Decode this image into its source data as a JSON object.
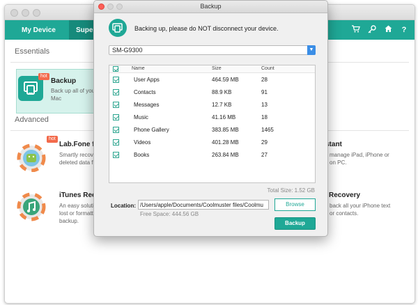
{
  "main": {
    "nav": {
      "my_device": "My Device",
      "super_toolkit": "Super"
    },
    "sections": {
      "essentials": "Essentials",
      "advanced": "Advanced"
    },
    "features": {
      "backup": {
        "title": "Backup",
        "desc1": "Back up all of your",
        "desc2": "Mac",
        "badge": "hot"
      },
      "labfone": {
        "title": "Lab.Fone fo",
        "desc1": "Smartly recove",
        "desc2": "deleted data fr",
        "badge": "hot"
      },
      "itunes": {
        "title": "iTunes Recov",
        "desc1": "An easy solution",
        "desc2": "lost or formatted",
        "desc3": "backup."
      },
      "assistant": {
        "title": "stant",
        "desc1": "manage iPad, iPhone or",
        "desc2": "on PC."
      },
      "recovery": {
        "title": "Recovery",
        "desc1": "back all your iPhone text",
        "desc2": "or contacts."
      }
    }
  },
  "dialog": {
    "title": "Backup",
    "status": "Backing up, please do NOT disconnect your device.",
    "device": "SM-G9300",
    "columns": {
      "name": "Name",
      "size": "Size",
      "count": "Count"
    },
    "items": [
      {
        "name": "User Apps",
        "size": "464.59 MB",
        "count": "28"
      },
      {
        "name": "Contacts",
        "size": "88.9 KB",
        "count": "91"
      },
      {
        "name": "Messages",
        "size": "12.7 KB",
        "count": "13"
      },
      {
        "name": "Music",
        "size": "41.16 MB",
        "count": "18"
      },
      {
        "name": "Phone Gallery",
        "size": "383.85 MB",
        "count": "1465"
      },
      {
        "name": "Videos",
        "size": "401.28 MB",
        "count": "29"
      },
      {
        "name": "Books",
        "size": "263.84 MB",
        "count": "27"
      }
    ],
    "total_size": "Total Size: 1.52 GB",
    "location_label": "Location:",
    "location_path": "/Users/apple/Documents/Coolmuster files/Coolmu",
    "free_space": "Free Space: 444.56 GB",
    "browse": "Browse",
    "backup": "Backup"
  },
  "colors": {
    "accent": "#1fa896",
    "accent_dark": "#168a7b",
    "hot": "#f36a4b",
    "dropdown": "#3b8ee6"
  }
}
